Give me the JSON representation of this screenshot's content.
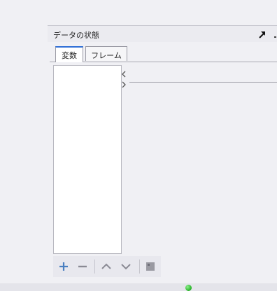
{
  "panel": {
    "title": "データの状態"
  },
  "tabs": [
    {
      "label": "変数",
      "active": true
    },
    {
      "label": "フレーム",
      "active": false
    }
  ],
  "toolbar": {
    "buttons": [
      "add-icon",
      "remove-icon",
      "move-up-icon",
      "move-down-icon",
      "view-icon"
    ]
  },
  "status": {
    "indicator_color": "#24b024"
  },
  "colors": {
    "active_tab_accent": "#2f6fd6",
    "icon_blue": "#4a7fc0",
    "icon_gray": "#8a8a94"
  }
}
